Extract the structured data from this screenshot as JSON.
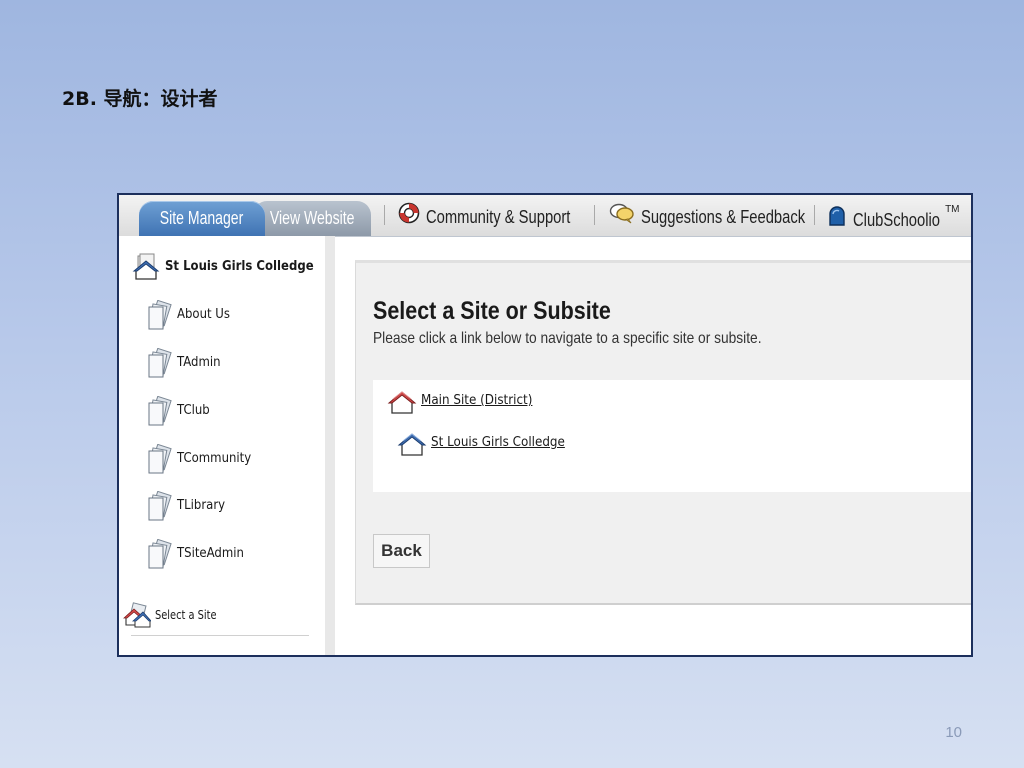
{
  "slide": {
    "title": "2B. 导航：设计者",
    "page_number": "10"
  },
  "tabs": {
    "site_manager": "Site Manager",
    "view_website": "View Website"
  },
  "top_nav": {
    "community": "Community & Support",
    "suggestions": "Suggestions & Feedback",
    "clubschoolio": "ClubSchoolio",
    "tm": "TM"
  },
  "sidebar": {
    "root": "St Louis Girls Colledge",
    "items": [
      "About Us",
      "TAdmin",
      "TClub",
      "TCommunity",
      "TLibrary",
      "TSiteAdmin"
    ],
    "select_site": "Select a Site"
  },
  "main": {
    "heading": "Select a Site or Subsite",
    "subheading": "Please click a link below to navigate to a specific site or subsite.",
    "links": [
      "Main Site (District)",
      "St Louis Girls Colledge"
    ],
    "back_label": "Back"
  },
  "colors": {
    "active_tab": "#4f82bf",
    "frame_border": "#1c2f5c",
    "main_site_roof": "#d44a4a",
    "subsite_roof": "#3f6fb5"
  },
  "icons": {
    "community": "lifebuoy-icon",
    "suggestions": "speech-bubbles-icon",
    "clubschoolio": "clubschoolio-logo-icon",
    "site": "house-icon",
    "subsite": "page-stack-icon"
  }
}
